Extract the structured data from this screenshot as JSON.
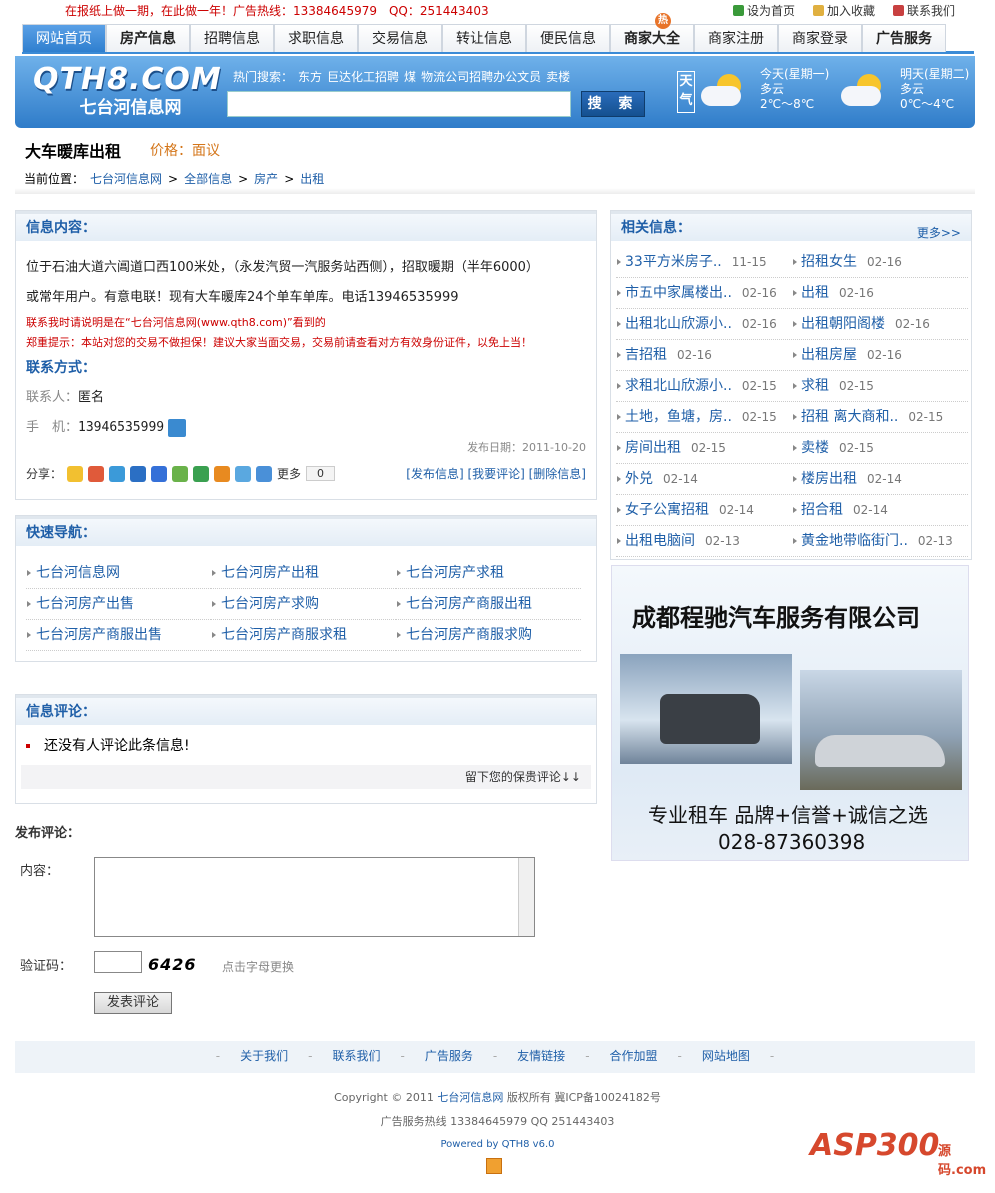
{
  "top": {
    "message": "在报纸上做一期，在此做一年！广告热线：13384645979　QQ：251443403",
    "links": [
      "设为首页",
      "加入收藏",
      "联系我们"
    ]
  },
  "nav": {
    "tabs": [
      "网站首页",
      "房产信息",
      "招聘信息",
      "求职信息",
      "交易信息",
      "转让信息",
      "便民信息",
      "商家大全",
      "商家注册",
      "商家登录",
      "广告服务"
    ],
    "hot_badge": "热"
  },
  "logo": {
    "en": "QTH8.COM",
    "cn": "七台河信息网"
  },
  "search": {
    "hot_label": "热门搜索：",
    "hot": [
      "东方",
      "巨达化工招聘",
      "煤",
      "物流公司招聘办公文员",
      "卖楼"
    ],
    "button": "搜 索"
  },
  "weather": {
    "label": "天气",
    "today": {
      "day": "今天(星期一)",
      "cond": "多云",
      "temp": "2℃～8℃"
    },
    "tomorrow": {
      "day": "明天(星期二)",
      "cond": "多云",
      "temp": "0℃～4℃"
    }
  },
  "page": {
    "title": "大车暖库出租",
    "price_label": "价格：",
    "price": "面议"
  },
  "breadcrumb": {
    "label": "当前位置：",
    "items": [
      "七台河信息网",
      "全部信息",
      "房产",
      "出租"
    ]
  },
  "info": {
    "heading": "信息内容：",
    "text1": "位于石油大道六阊道口西100米处，（永发汽贸一汽服务站西侧），招取暖期（半年6000）",
    "text2": "或常年用户。有意电联！现有大车暖库24个单车单库。电话13946535999",
    "note1": "联系我时请说明是在“七台河信息网(www.qth8.com)”看到的",
    "note2": "郑重提示：本站对您的交易不做担保！建议大家当面交易，交易前请查看对方有效身份证件，以免上当！",
    "contact_heading": "联系方式：",
    "contact_label": "联系人：",
    "contact_name": "匿名",
    "phone_label": "手　机：",
    "phone": "13946535999",
    "pub_date": "发布日期：2011-10-20",
    "share_label": "分享：",
    "share_more": "更多",
    "share_count": "0",
    "actions": "[发布信息] [我要评论] [删除信息]"
  },
  "quick": {
    "heading": "快速导航：",
    "links": [
      "七台河信息网",
      "七台河房产出租",
      "七台河房产求租",
      "七台河房产出售",
      "七台河房产求购",
      "七台河房产商服出租",
      "七台河房产商服出售",
      "七台河房产商服求租",
      "七台河房产商服求购"
    ]
  },
  "comments": {
    "heading": "信息评论：",
    "empty": "还没有人评论此条信息!",
    "footer": "留下您的保贵评论↓↓"
  },
  "post": {
    "heading": "发布评论：",
    "content_label": "内容：",
    "captcha_label": "验证码：",
    "captcha": "6426",
    "captcha_tip": "点击字母更换",
    "submit": "发表评论"
  },
  "related": {
    "heading": "相关信息：",
    "more": "更多>>",
    "rows": [
      [
        "33平方米房子..",
        "11-15",
        "招租女生",
        "02-16"
      ],
      [
        "市五中家属楼出..",
        "02-16",
        "出租",
        "02-16"
      ],
      [
        "出租北山欣源小..",
        "02-16",
        "出租朝阳阁楼",
        "02-16"
      ],
      [
        "吉招租",
        "02-16",
        "出租房屋",
        "02-16"
      ],
      [
        "求租北山欣源小..",
        "02-15",
        "求租",
        "02-15"
      ],
      [
        "土地，鱼塘，房..",
        "02-15",
        "招租 离大商和..",
        "02-15"
      ],
      [
        "房间出租",
        "02-15",
        "卖楼",
        "02-15"
      ],
      [
        "外兑",
        "02-14",
        "楼房出租",
        "02-14"
      ],
      [
        "女子公寓招租",
        "02-14",
        "招合租",
        "02-14"
      ],
      [
        "出租电脑间",
        "02-13",
        "黄金地带临街门..",
        "02-13"
      ]
    ]
  },
  "ad": {
    "title": "成都程驰汽车服务有限公司",
    "slogan": "专业租车 品牌+信誉+诚信之选",
    "phone": "028-87360398"
  },
  "footer": {
    "links": [
      "关于我们",
      "联系我们",
      "广告服务",
      "友情链接",
      "合作加盟",
      "网站地图"
    ],
    "copyright_pre": "Copyright © 2011",
    "site": "七台河信息网",
    "copyright_post": "版权所有 冀ICP备10024182号",
    "hotline": "广告服务热线 13384645979 QQ 251443403",
    "powered": "Powered by QTH8 v6.0"
  },
  "watermark": {
    "text": "ASP300",
    "sub": "源码.com"
  }
}
